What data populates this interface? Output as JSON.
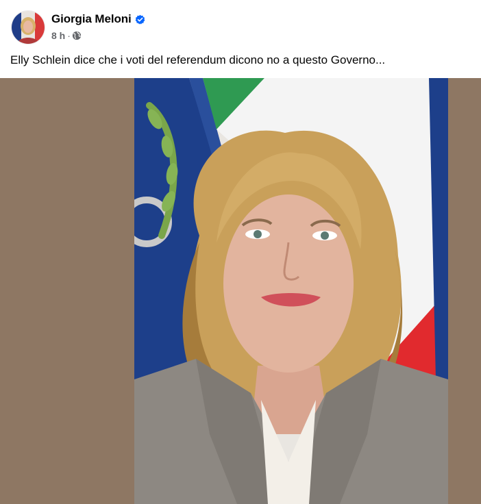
{
  "post": {
    "author": "Giorgia Meloni",
    "timestamp": "8 h",
    "separator": "·",
    "text": "Elly Schlein dice che i voti del referendum dicono no a questo Governo...",
    "icons": {
      "verified": "verified-badge-icon",
      "audience": "globe-icon"
    }
  },
  "colors": {
    "verified": "#0866ff",
    "media_background": "#8e7763",
    "flag_green": "#2f9a52",
    "flag_white": "#f4f4f4",
    "flag_red": "#e12a2e",
    "flag_blue": "#1d3f8a"
  }
}
